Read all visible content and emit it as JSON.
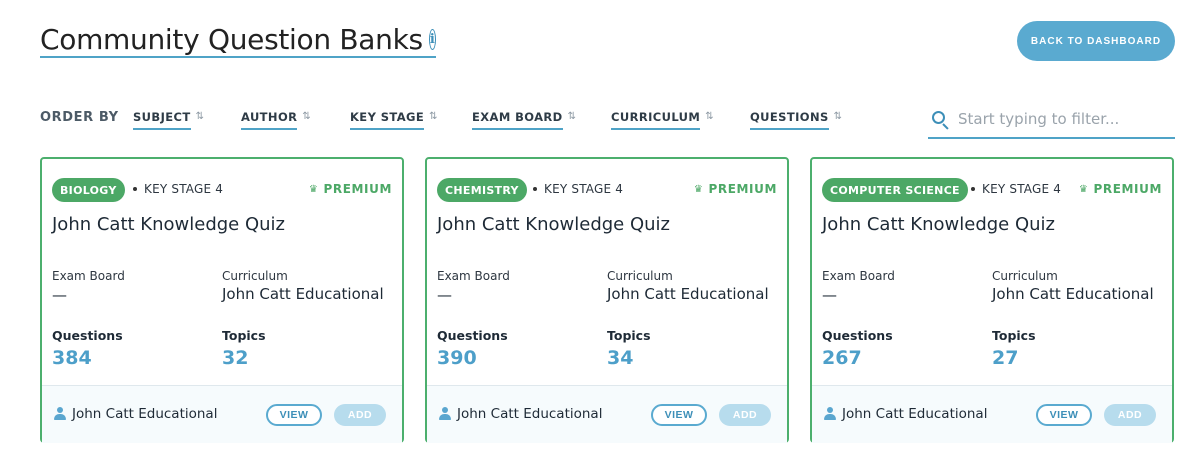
{
  "header": {
    "title": "Community Question Banks",
    "info_glyph": "i",
    "back_button": "BACK TO DASHBOARD"
  },
  "toolbar": {
    "order_by_label": "ORDER BY",
    "sort_options": [
      "SUBJECT",
      "AUTHOR",
      "KEY STAGE",
      "EXAM BOARD",
      "CURRICULUM",
      "QUESTIONS"
    ],
    "filter_placeholder": "Start typing to filter..."
  },
  "cards": [
    {
      "subject": "BIOLOGY",
      "key_stage": "KEY STAGE 4",
      "badge": "PREMIUM",
      "name": "John Catt Knowledge Quiz",
      "exam_board_label": "Exam Board",
      "exam_board": "—",
      "curriculum_label": "Curriculum",
      "curriculum": "John Catt Educational",
      "questions_label": "Questions",
      "questions": "384",
      "topics_label": "Topics",
      "topics": "32",
      "author": "John Catt Educational",
      "view_label": "VIEW",
      "add_label": "ADD"
    },
    {
      "subject": "CHEMISTRY",
      "key_stage": "KEY STAGE 4",
      "badge": "PREMIUM",
      "name": "John Catt Knowledge Quiz",
      "exam_board_label": "Exam Board",
      "exam_board": "—",
      "curriculum_label": "Curriculum",
      "curriculum": "John Catt Educational",
      "questions_label": "Questions",
      "questions": "390",
      "topics_label": "Topics",
      "topics": "34",
      "author": "John Catt Educational",
      "view_label": "VIEW",
      "add_label": "ADD"
    },
    {
      "subject": "COMPUTER SCIENCE",
      "key_stage": "KEY STAGE 4",
      "badge": "PREMIUM",
      "name": "John Catt Knowledge Quiz",
      "exam_board_label": "Exam Board",
      "exam_board": "—",
      "curriculum_label": "Curriculum",
      "curriculum": "John Catt Educational",
      "questions_label": "Questions",
      "questions": "267",
      "topics_label": "Topics",
      "topics": "27",
      "author": "John Catt Educational",
      "view_label": "VIEW",
      "add_label": "ADD"
    }
  ],
  "colors": {
    "accent": "#5aaad0",
    "subject_green": "#4ca866",
    "card_border": "#4caf6d",
    "stat_blue": "#4d9fc9"
  },
  "icons": {
    "info": "info-icon",
    "sort": "sort-icon",
    "search": "search-icon",
    "premium": "crown-icon",
    "author": "user-icon"
  }
}
